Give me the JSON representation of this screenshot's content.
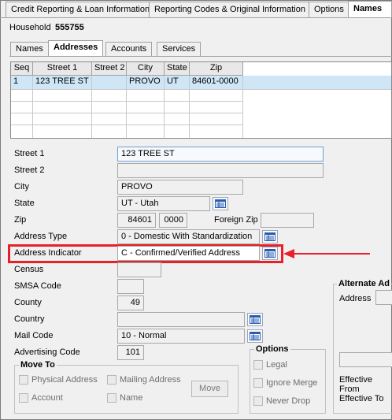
{
  "top_tabs": [
    "Credit Reporting & Loan Information",
    "Reporting Codes & Original Information",
    "Options",
    "Names"
  ],
  "household": {
    "label": "Household",
    "value": "555755"
  },
  "sub_tabs": [
    "Names",
    "Addresses",
    "Accounts",
    "Services"
  ],
  "grid": {
    "columns": [
      "Seq",
      "Street 1",
      "Street 2",
      "City",
      "State",
      "Zip"
    ],
    "rows": [
      {
        "seq": "1",
        "street1": "123 TREE ST",
        "street2": "",
        "city": "PROVO",
        "state": "UT",
        "zip": "84601-0000"
      }
    ]
  },
  "form": {
    "street1": {
      "label": "Street 1",
      "value": "123 TREE ST"
    },
    "street2": {
      "label": "Street 2",
      "value": ""
    },
    "city": {
      "label": "City",
      "value": "PROVO"
    },
    "state": {
      "label": "State",
      "value": "UT - Utah"
    },
    "zip": {
      "label": "Zip",
      "value": "84601",
      "plus4": "0000",
      "foreign_label": "Foreign Zip",
      "foreign_value": ""
    },
    "address_type": {
      "label": "Address Type",
      "value": "0 - Domestic With Standardization"
    },
    "address_indicator": {
      "label": "Address Indicator",
      "value": "C - Confirmed/Verified Address"
    },
    "census": {
      "label": "Census",
      "value": ""
    },
    "smsa": {
      "label": "SMSA Code",
      "value": ""
    },
    "county": {
      "label": "County",
      "value": "49"
    },
    "country": {
      "label": "Country",
      "value": ""
    },
    "mail_code": {
      "label": "Mail Code",
      "value": "10 - Normal"
    },
    "advertising_code": {
      "label": "Advertising Code",
      "value": "101"
    }
  },
  "move_to": {
    "title": "Move To",
    "physical_address": "Physical Address",
    "mailing_address": "Mailing Address",
    "account": "Account",
    "name": "Name",
    "move_button": "Move"
  },
  "options": {
    "title": "Options",
    "legal": "Legal",
    "ignore_merge": "Ignore Merge",
    "never_drop": "Never Drop"
  },
  "alternate": {
    "title": "Alternate Ad",
    "address_label": "Address",
    "effective_from": "Effective From",
    "effective_to": "Effective To"
  },
  "colors": {
    "highlight_box": "#e8202a",
    "arrow": "#e8202a",
    "selected_row": "#cfe6f7",
    "input_focus_border": "#6f9fd2"
  },
  "icons": {
    "lookup": "list-lookup-icon",
    "arrow": "left-arrow-icon"
  }
}
